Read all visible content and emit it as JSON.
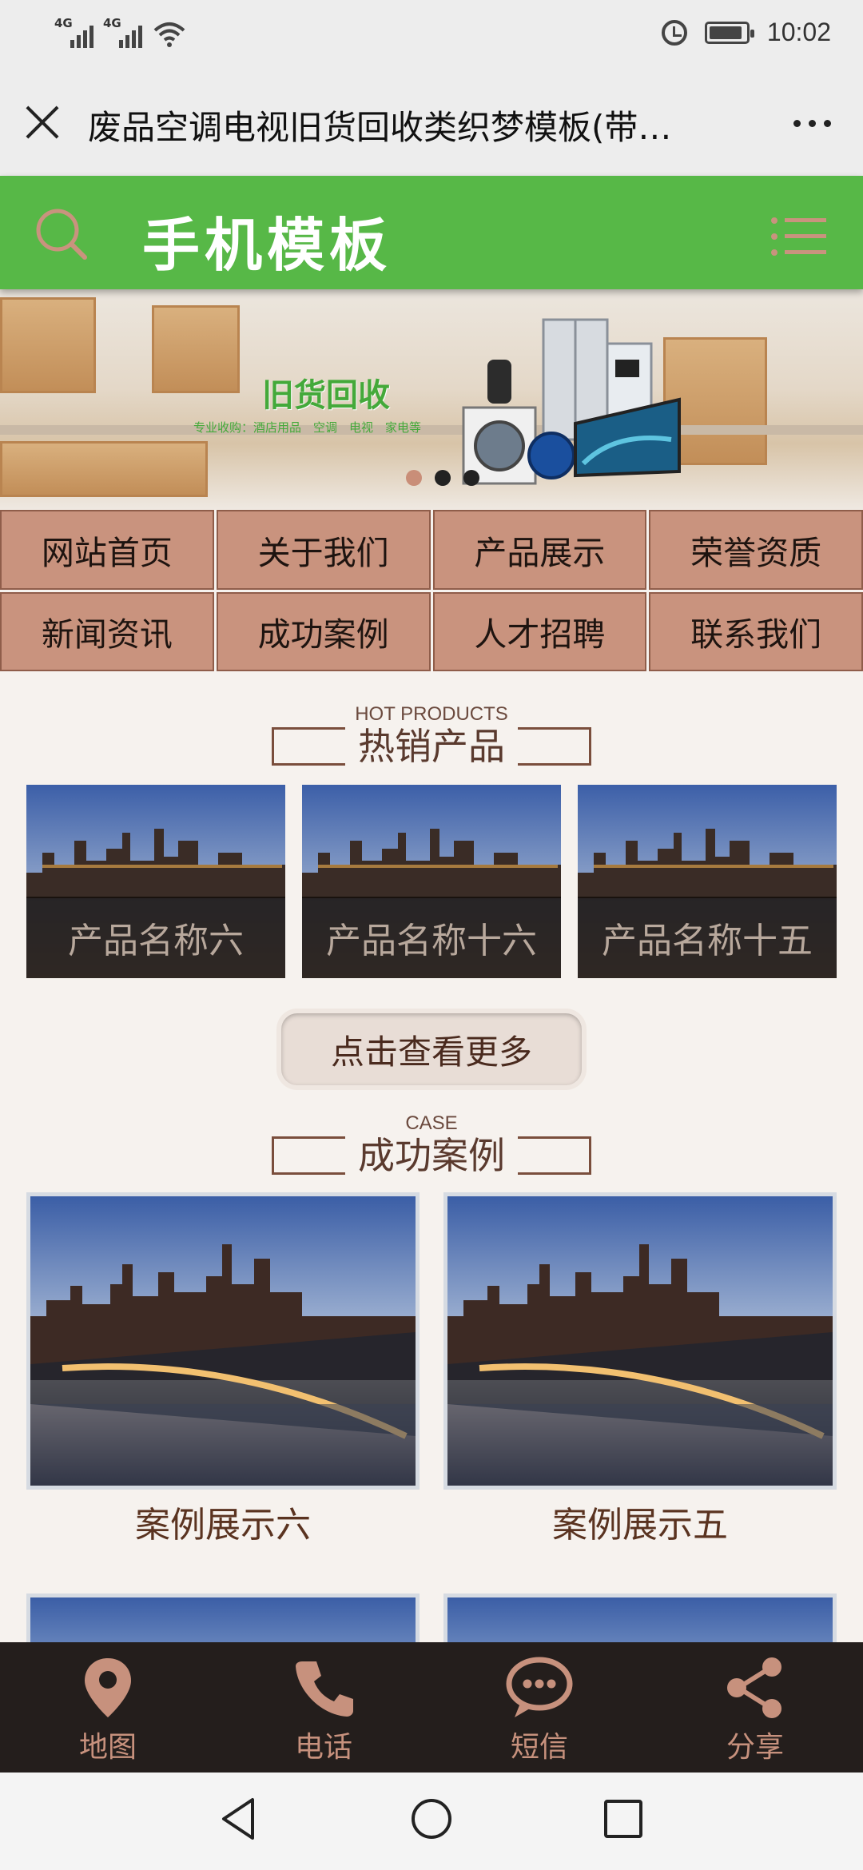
{
  "status": {
    "signal1": "4G",
    "signal2": "4G",
    "time": "10:02",
    "battery_level": 0.9
  },
  "titlebar": {
    "title": "废品空调电视旧货回收类织梦模板(带…"
  },
  "header": {
    "logo": "手机模板",
    "accent": "#57b847"
  },
  "banner": {
    "title": "旧货回收",
    "subtitle": "专业收购：酒店用品　空调　电视　家电等",
    "slides": 3,
    "active_slide": 1
  },
  "nav": {
    "items": [
      {
        "label": "网站首页"
      },
      {
        "label": "关于我们"
      },
      {
        "label": "产品展示"
      },
      {
        "label": "荣誉资质"
      },
      {
        "label": "新闻资讯"
      },
      {
        "label": "成功案例"
      },
      {
        "label": "人才招聘"
      },
      {
        "label": "联系我们"
      }
    ]
  },
  "hot_products": {
    "en": "HOT PRODUCTS",
    "zh": "热销产品",
    "items": [
      {
        "name": "产品名称六"
      },
      {
        "name": "产品名称十六"
      },
      {
        "name": "产品名称十五"
      }
    ],
    "more_label": "点击查看更多"
  },
  "cases": {
    "en": "CASE",
    "zh": "成功案例",
    "items": [
      {
        "name": "案例展示六"
      },
      {
        "name": "案例展示五"
      }
    ]
  },
  "tabbar": {
    "items": [
      {
        "label": "地图",
        "icon": "map-pin-icon"
      },
      {
        "label": "电话",
        "icon": "phone-icon"
      },
      {
        "label": "短信",
        "icon": "message-icon"
      },
      {
        "label": "分享",
        "icon": "share-icon"
      }
    ],
    "color": "#c7917d"
  }
}
